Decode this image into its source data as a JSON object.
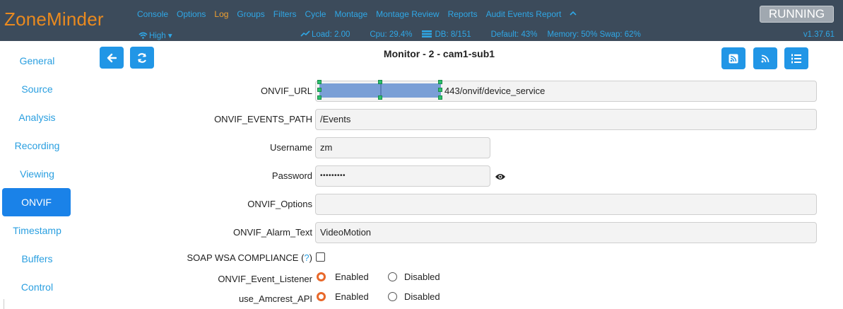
{
  "app": {
    "logo": "ZoneMinder",
    "status": "RUNNING",
    "version": "v1.37.61"
  },
  "nav": {
    "items": [
      "Console",
      "Options",
      "Log",
      "Groups",
      "Filters",
      "Cycle",
      "Montage",
      "Montage Review",
      "Reports",
      "Audit Events Report"
    ],
    "active": "Log",
    "caret": "^"
  },
  "stats": {
    "bandwidth": "High",
    "bandwidth_caret": "▾",
    "load": "Load: 2.00",
    "cpu": "Cpu: 29.4%",
    "db": "DB: 8/151",
    "default": "Default: 43%",
    "memory": "Memory: 50% Swap: 62%"
  },
  "sidebar": {
    "items": [
      "General",
      "Source",
      "Analysis",
      "Recording",
      "Viewing",
      "ONVIF",
      "Timestamp",
      "Buffers",
      "Control"
    ],
    "active": "ONVIF"
  },
  "page": {
    "title": "Monitor - 2 - cam1-sub1"
  },
  "form": {
    "onvif_url": {
      "label": "ONVIF_URL",
      "value": "443/onvif/device_service"
    },
    "onvif_events_path": {
      "label": "ONVIF_EVENTS_PATH",
      "value": "/Events"
    },
    "username": {
      "label": "Username",
      "value": "zm"
    },
    "password": {
      "label": "Password",
      "value": "•••••••••"
    },
    "onvif_options": {
      "label": "ONVIF_Options",
      "value": ""
    },
    "onvif_alarm_text": {
      "label": "ONVIF_Alarm_Text",
      "value": "VideoMotion"
    },
    "soap_wsa": {
      "label": "SOAP WSA COMPLIANCE (",
      "help": "?",
      "label_end": ")",
      "checked": false
    },
    "onvif_event_listener": {
      "label": "ONVIF_Event_Listener",
      "options": [
        "Enabled",
        "Disabled"
      ],
      "selected": "Enabled"
    },
    "use_amcrest_api": {
      "label": "use_Amcrest_API",
      "options": [
        "Enabled",
        "Disabled"
      ],
      "selected": "Enabled"
    }
  },
  "colors": {
    "navbar": "#3c4b5b",
    "logo": "#ea8a1f",
    "link": "#2fa7e6",
    "button": "#2196e6",
    "radio_on": "#e8682a"
  }
}
